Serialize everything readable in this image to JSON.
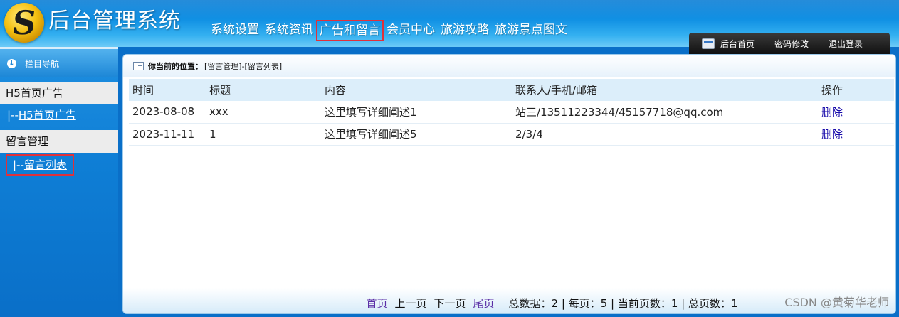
{
  "header": {
    "brand": "后台管理系统",
    "logo_letter": "S",
    "nav": [
      {
        "label": "系统设置",
        "active": false
      },
      {
        "label": "系统资讯",
        "active": false
      },
      {
        "label": "广告和留言",
        "active": true
      },
      {
        "label": "会员中心",
        "active": false
      },
      {
        "label": "旅游攻略",
        "active": false
      },
      {
        "label": "旅游景点图文",
        "active": false
      }
    ],
    "quick_links": [
      "后台首页",
      "密码修改",
      "退出登录"
    ]
  },
  "sidebar": {
    "title": "栏目导航",
    "groups": [
      {
        "title": "H5首页广告",
        "prefix": "|--",
        "link": "H5首页广告"
      },
      {
        "title": "留言管理",
        "prefix": "|--",
        "link": "留言列表"
      }
    ]
  },
  "location": {
    "label": "你当前的位置：",
    "path": "[留言管理]-[留言列表]"
  },
  "table": {
    "columns": [
      "时间",
      "标题",
      "内容",
      "联系人/手机/邮箱",
      "操作"
    ],
    "rows": [
      {
        "time": "2023-08-08",
        "title": "xxx",
        "content": "这里填写详细阐述1",
        "contact": "站三/13511223344/45157718@qq.com",
        "action": "删除"
      },
      {
        "time": "2023-11-11",
        "title": "1",
        "content": "这里填写详细阐述5",
        "contact": "2/3/4",
        "action": "删除"
      }
    ]
  },
  "pager": {
    "first": "首页",
    "prev": "上一页",
    "next": "下一页",
    "last": "尾页",
    "stats": "总数据：2 | 每页：5 | 当前页数：1 | 总页数：1"
  },
  "watermark": "CSDN @黄菊华老师",
  "colors": {
    "header_blue": "#0f8fe3",
    "highlight_red": "#e0313a",
    "link_blue": "#1a0dab"
  }
}
